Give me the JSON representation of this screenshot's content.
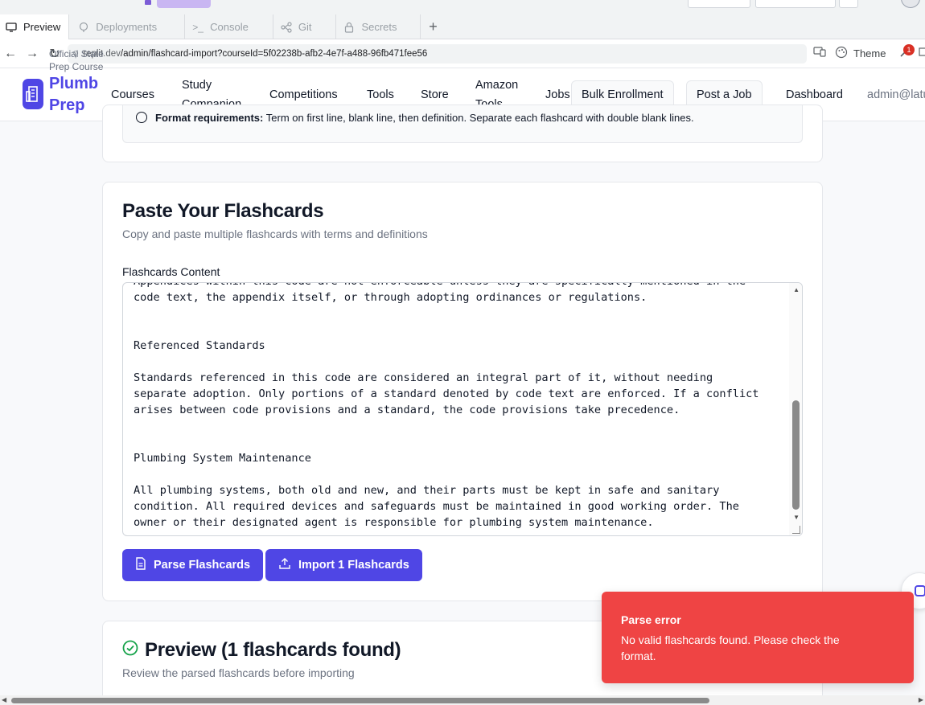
{
  "browser": {
    "tabs": [
      {
        "label": "Preview",
        "active": true,
        "icon": "monitor-icon"
      },
      {
        "label": "Deployments",
        "active": false,
        "icon": "deploy-icon"
      },
      {
        "label": "Console",
        "active": false,
        "icon": "terminal-icon"
      },
      {
        "label": "Git",
        "active": false,
        "icon": "git-icon"
      },
      {
        "label": "Secrets",
        "active": false,
        "icon": "lock-icon"
      }
    ],
    "url_host": ".replit.dev",
    "url_path": "/admin/flashcard-import?courseId=5f02238b-afb2-4e7f-a488-96fb471fee56",
    "theme_label": "Theme",
    "notification_count": "1"
  },
  "header": {
    "logo_line1": "Plumb",
    "logo_line2": "Prep",
    "logo_sub1": "Official State",
    "logo_sub2": "Prep Course",
    "nav": [
      "Courses",
      "Study",
      "Companion",
      "Competitions",
      "Tools",
      "Store",
      "Amazon",
      "Tools",
      "Jobs"
    ],
    "bulk_enrollment": "Bulk Enrollment",
    "post_job": "Post a Job",
    "dashboard": "Dashboard",
    "user": "admin@latu"
  },
  "format_requirements": {
    "label": "Format requirements:",
    "text": "Term on first line, blank line, then definition. Separate each flashcard with double blank lines."
  },
  "paste_card": {
    "title": "Paste Your Flashcards",
    "description": "Copy and paste multiple flashcards with terms and definitions",
    "field_label": "Flashcards Content",
    "content_lines": [
      "Appendices within this code are not enforceable unless they are specifically mentioned in the",
      "code text, the appendix itself, or through adopting ordinances or regulations.",
      "",
      "",
      "Referenced Standards",
      "",
      "Standards referenced in this code are considered an integral part of it, without needing",
      "separate adoption. Only portions of a standard denoted by code text are enforced. If a conflict",
      "arises between code provisions and a standard, the code provisions take precedence.",
      "",
      "",
      "Plumbing System Maintenance",
      "",
      "All plumbing systems, both old and new, and their parts must be kept in safe and sanitary",
      "condition. All required devices and safeguards must be maintained in good working order. The",
      "owner or their designated agent is responsible for plumbing system maintenance."
    ],
    "parse_button": "Parse Flashcards",
    "import_button": "Import 1 Flashcards"
  },
  "preview_card": {
    "title": "Preview (1 flashcards found)",
    "description": "Review the parsed flashcards before importing"
  },
  "toast": {
    "title": "Parse error",
    "message": "No valid flashcards found. Please check the format."
  },
  "colors": {
    "accent": "#4f46e5",
    "error": "#ef4444",
    "success": "#16a34a"
  }
}
